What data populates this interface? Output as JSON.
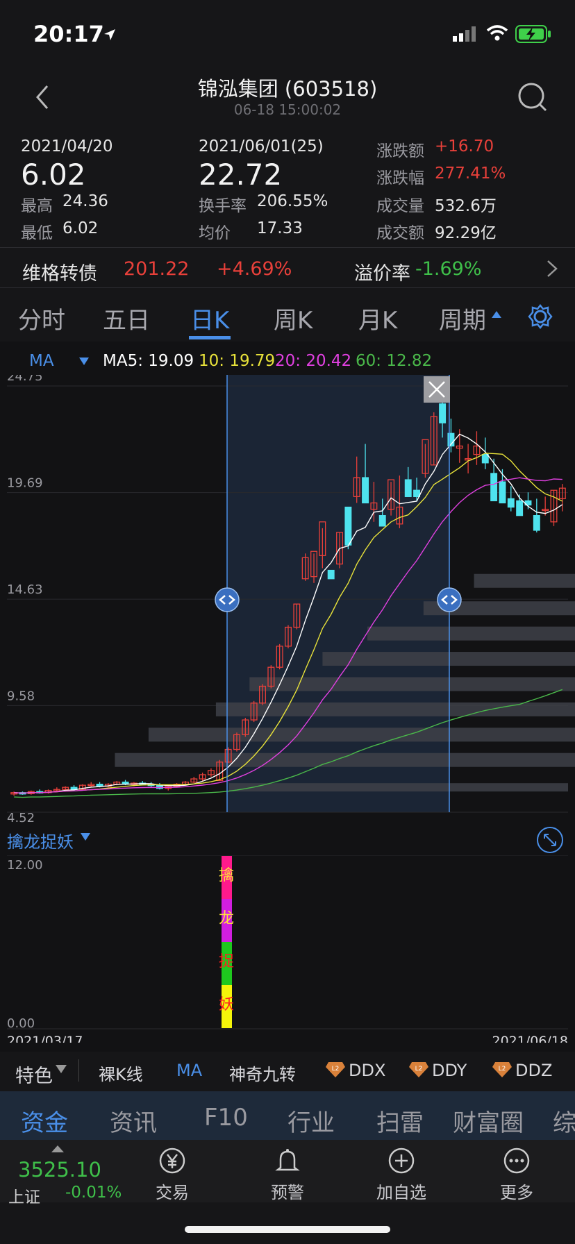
{
  "status_bar": {
    "time": "20:17"
  },
  "header": {
    "title": "锦泓集团 (603518)",
    "subtitle": "06-18 15:00:02"
  },
  "quote": {
    "col1": {
      "date": "2021/04/20",
      "price": "6.02",
      "high_label": "最高",
      "high": "24.36",
      "low_label": "最低",
      "low": "6.02"
    },
    "col2": {
      "date": "2021/06/01(25)",
      "price": "22.72",
      "turnover_label": "换手率",
      "turnover": "206.55%",
      "avg_label": "均价",
      "avg": "17.33"
    },
    "col3": {
      "chg_amt_label": "涨跌额",
      "chg_amt": "+16.70",
      "chg_pct_label": "涨跌幅",
      "chg_pct": "277.41%",
      "vol_label": "成交量",
      "vol": "532.6万",
      "amount_label": "成交额",
      "amount": "92.29亿"
    }
  },
  "bond": {
    "name": "维格转债",
    "price": "201.22",
    "change": "+4.69%",
    "premium_label": "溢价率",
    "premium": "-1.69%"
  },
  "period_tabs": [
    {
      "label": "分时"
    },
    {
      "label": "五日"
    },
    {
      "label": "日K"
    },
    {
      "label": "周K"
    },
    {
      "label": "月K"
    },
    {
      "label": "周期"
    }
  ],
  "ma_legend": {
    "name": "MA",
    "ma5": "MA5: 19.09",
    "ma10": "10: 19.79",
    "ma20": "20: 20.42",
    "ma60": "60: 12.82",
    "colors": {
      "ma5": "#ffffff",
      "ma10": "#e8e23a",
      "ma20": "#e040e0",
      "ma60": "#4ab84a"
    }
  },
  "chart_data": {
    "type": "candlestick",
    "y_ticks": [
      "24.75",
      "19.69",
      "14.63",
      "9.58",
      "4.52"
    ],
    "ylim": [
      4.52,
      24.75
    ],
    "x_start": "2021/03/17",
    "x_end": "2021/06/18",
    "candles": [
      [
        5.4,
        5.5,
        5.3,
        5.45
      ],
      [
        5.45,
        5.5,
        5.35,
        5.4
      ],
      [
        5.4,
        5.55,
        5.35,
        5.5
      ],
      [
        5.5,
        5.6,
        5.4,
        5.45
      ],
      [
        5.45,
        5.6,
        5.4,
        5.55
      ],
      [
        5.55,
        5.7,
        5.5,
        5.6
      ],
      [
        5.6,
        5.75,
        5.5,
        5.7
      ],
      [
        5.7,
        5.8,
        5.55,
        5.6
      ],
      [
        5.6,
        5.85,
        5.55,
        5.8
      ],
      [
        5.8,
        5.95,
        5.7,
        5.85
      ],
      [
        5.85,
        5.95,
        5.7,
        5.75
      ],
      [
        5.75,
        5.9,
        5.7,
        5.85
      ],
      [
        5.85,
        6.0,
        5.8,
        5.95
      ],
      [
        5.95,
        6.05,
        5.8,
        5.85
      ],
      [
        5.85,
        5.95,
        5.75,
        5.9
      ],
      [
        5.9,
        6.0,
        5.8,
        5.85
      ],
      [
        5.85,
        5.95,
        5.7,
        5.8
      ],
      [
        5.8,
        5.9,
        5.6,
        5.65
      ],
      [
        5.65,
        5.8,
        5.55,
        5.75
      ],
      [
        5.75,
        5.9,
        5.7,
        5.85
      ],
      [
        5.85,
        6.0,
        5.8,
        5.95
      ],
      [
        5.95,
        6.2,
        5.9,
        6.1
      ],
      [
        6.1,
        6.4,
        6.0,
        6.3
      ],
      [
        6.3,
        6.6,
        6.2,
        6.5
      ],
      [
        6.02,
        7.0,
        6.0,
        6.9
      ],
      [
        6.9,
        7.6,
        6.85,
        7.5
      ],
      [
        7.5,
        8.3,
        7.4,
        8.2
      ],
      [
        8.2,
        9.0,
        8.1,
        8.9
      ],
      [
        8.9,
        9.8,
        8.8,
        9.7
      ],
      [
        9.7,
        10.6,
        9.6,
        10.5
      ],
      [
        10.5,
        11.5,
        10.4,
        11.4
      ],
      [
        11.4,
        12.5,
        11.3,
        12.4
      ],
      [
        12.4,
        13.4,
        12.3,
        13.3
      ],
      [
        13.3,
        14.4,
        13.2,
        14.4
      ],
      [
        15.6,
        16.8,
        15.5,
        16.6
      ],
      [
        15.7,
        16.8,
        15.4,
        16.9
      ],
      [
        16.7,
        18.0,
        16.1,
        18.3
      ],
      [
        16.0,
        15.4,
        15.4,
        15.6
      ],
      [
        16.3,
        17.8,
        16.1,
        17.8
      ],
      [
        19.0,
        17.9,
        17.0,
        17.2
      ],
      [
        19.5,
        21.4,
        19.2,
        20.4
      ],
      [
        20.4,
        22.0,
        19.3,
        19.2
      ],
      [
        18.9,
        20.2,
        18.3,
        19.2
      ],
      [
        18.6,
        19.4,
        18.1,
        18.1
      ],
      [
        18.9,
        20.2,
        18.6,
        20.3
      ],
      [
        18.2,
        20.5,
        18.0,
        19.0
      ],
      [
        20.3,
        20.9,
        19.8,
        19.5
      ],
      [
        19.8,
        20.4,
        19.3,
        19.5
      ],
      [
        20.6,
        22.0,
        20.4,
        22.2
      ],
      [
        21.0,
        23.5,
        21.0,
        23.3
      ],
      [
        23.9,
        24.4,
        22.3,
        23.0
      ],
      [
        22.5,
        23.2,
        21.6,
        21.9
      ],
      [
        21.8,
        22.7,
        21.1,
        21.9
      ],
      [
        21.3,
        22.0,
        20.6,
        21.3
      ],
      [
        21.5,
        22.6,
        21.0,
        21.9
      ],
      [
        21.5,
        22.3,
        20.8,
        21.1
      ],
      [
        20.6,
        21.3,
        19.5,
        19.3
      ],
      [
        20.2,
        20.8,
        19.2,
        19.2
      ],
      [
        19.4,
        20.0,
        18.8,
        19.0
      ],
      [
        19.3,
        19.6,
        18.6,
        18.6
      ],
      [
        19.3,
        19.7,
        18.9,
        19.1
      ],
      [
        18.6,
        19.4,
        17.8,
        17.9
      ],
      [
        18.9,
        19.5,
        18.6,
        18.9
      ],
      [
        18.3,
        19.8,
        18.1,
        19.8
      ],
      [
        19.4,
        20.1,
        18.8,
        19.9
      ]
    ],
    "indicator": {
      "name": "擒龙捉妖",
      "y_top": "12.00",
      "y_bottom": "0.00",
      "chars": [
        "擒",
        "龙",
        "捉",
        "妖"
      ]
    }
  },
  "feature_bar": [
    "特色",
    "裸K线",
    "MA",
    "神奇九转",
    "DDX",
    "DDY",
    "DDZ"
  ],
  "bottom_tabs": [
    "资金",
    "资讯",
    "F10",
    "行业",
    "扫雷",
    "财富圈",
    "综"
  ],
  "dock": {
    "index_value": "3525.10",
    "index_name": "上证",
    "index_change": "-0.01%",
    "items": [
      "交易",
      "预警",
      "加自选",
      "更多"
    ]
  }
}
